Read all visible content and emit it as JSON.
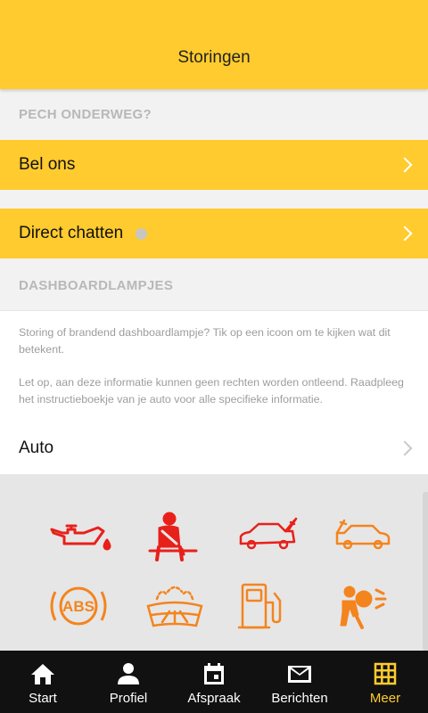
{
  "header": {
    "title": "Storingen"
  },
  "pech": {
    "section_title": "PECH ONDERWEG?",
    "call_label": "Bel ons",
    "chat_label": "Direct chatten"
  },
  "dashboard": {
    "section_title": "DASHBOARDLAMPJES",
    "info_1": "Storing of brandend dashboardlampje? Tik op een icoon om te kijken wat dit betekent.",
    "info_2": "Let op, aan deze informatie kunnen geen rechten worden ontleend. Raadpleeg het instructieboekje van je auto voor alle specifieke informatie.",
    "category_label": "Auto",
    "icons": [
      {
        "name": "oil-pressure-icon",
        "color": "#E8201A"
      },
      {
        "name": "seatbelt-icon",
        "color": "#E8201A"
      },
      {
        "name": "trunk-open-icon",
        "color": "#E8201A"
      },
      {
        "name": "hood-open-icon",
        "color": "#F4841E"
      },
      {
        "name": "abs-icon",
        "color": "#F4841E",
        "text": "ABS"
      },
      {
        "name": "washer-fluid-icon",
        "color": "#F4841E"
      },
      {
        "name": "fuel-icon",
        "color": "#F4841E"
      },
      {
        "name": "airbag-icon",
        "color": "#F4841E"
      }
    ]
  },
  "nav": {
    "items": [
      {
        "label": "Start",
        "icon": "home-icon"
      },
      {
        "label": "Profiel",
        "icon": "person-icon"
      },
      {
        "label": "Afspraak",
        "icon": "calendar-icon"
      },
      {
        "label": "Berichten",
        "icon": "mail-icon"
      },
      {
        "label": "Meer",
        "icon": "grid-icon",
        "active": true
      }
    ],
    "active_color": "#FFCB2E"
  },
  "colors": {
    "brand_yellow": "#FFCB2E",
    "warning_red": "#E8201A",
    "warning_orange": "#F4841E"
  }
}
